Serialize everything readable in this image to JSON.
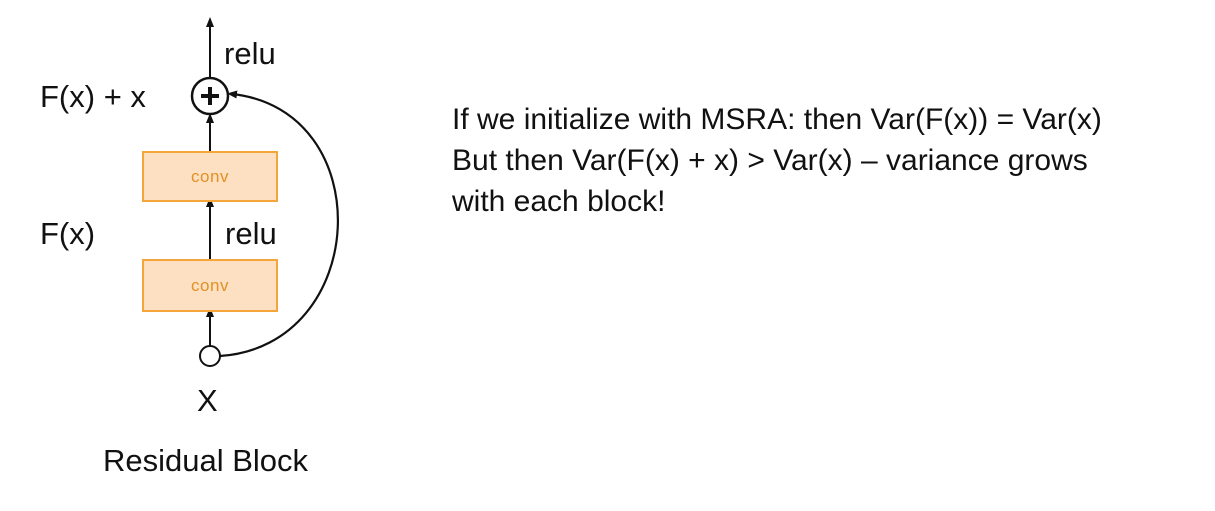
{
  "diagram": {
    "top_relu": "relu",
    "sum_label": "F(x) + x",
    "plus_symbol": "+",
    "conv_top": "conv",
    "fx_label": "F(x)",
    "mid_relu": "relu",
    "conv_bottom": "conv",
    "input_label": "X",
    "caption": "Residual Block"
  },
  "note": {
    "lines": [
      "If we initialize with MSRA: then Var(F(x)) = Var(x)",
      "But then Var(F(x) + x) > Var(x) – variance grows",
      "with each block!"
    ]
  },
  "colors": {
    "conv_fill": "#fde0c2",
    "conv_border": "#f5a53a",
    "conv_text": "#e39024",
    "ink": "#111111"
  },
  "icons": {
    "sum_node": "plus-circle-icon",
    "input_node": "circle-icon",
    "arrows": "arrow-up-icon",
    "skip": "curved-arrow-icon"
  }
}
